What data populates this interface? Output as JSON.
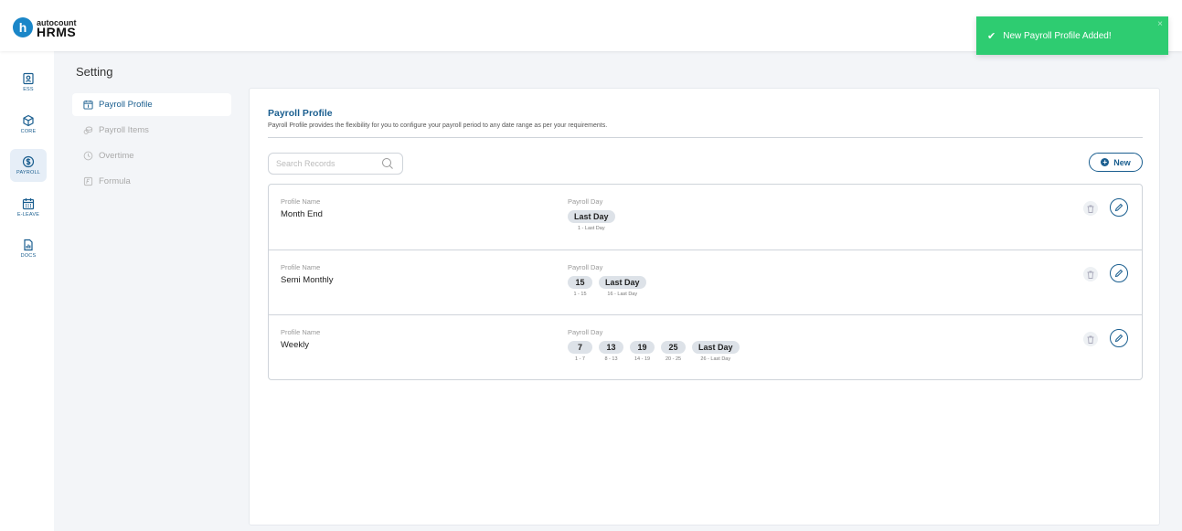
{
  "logo": {
    "brand_small": "autocount",
    "brand_large": "HRMS"
  },
  "toast": {
    "message": "New Payroll Profile Added!",
    "close": "×"
  },
  "nav": [
    {
      "label": "ESS"
    },
    {
      "label": "CORE"
    },
    {
      "label": "PAYROLL"
    },
    {
      "label": "E-LEAVE"
    },
    {
      "label": "DOCS"
    }
  ],
  "setting": {
    "title": "Setting",
    "menu": [
      {
        "label": "Payroll Profile"
      },
      {
        "label": "Payroll Items"
      },
      {
        "label": "Overtime"
      },
      {
        "label": "Formula"
      }
    ]
  },
  "panel": {
    "title": "Payroll Profile",
    "description": "Payroll Profile provides the flexibility for you to configure your payroll period to any date range as per your requirements.",
    "search_placeholder": "Search Records",
    "new_label": "New",
    "col_profile": "Profile Name",
    "col_day": "Payroll Day",
    "profiles": [
      {
        "name": "Month End",
        "days": [
          {
            "day": "Last Day",
            "range": "1 - Last Day"
          }
        ]
      },
      {
        "name": "Semi Monthly",
        "days": [
          {
            "day": "15",
            "range": "1 - 15"
          },
          {
            "day": "Last Day",
            "range": "16 - Last Day"
          }
        ]
      },
      {
        "name": "Weekly",
        "days": [
          {
            "day": "7",
            "range": "1 - 7"
          },
          {
            "day": "13",
            "range": "8 - 13"
          },
          {
            "day": "19",
            "range": "14 - 19"
          },
          {
            "day": "25",
            "range": "20 - 25"
          },
          {
            "day": "Last Day",
            "range": "26 - Last Day"
          }
        ]
      }
    ]
  },
  "colors": {
    "accent": "#1a5e8f",
    "toast": "#2ecc71",
    "chip": "#dde2e8"
  }
}
